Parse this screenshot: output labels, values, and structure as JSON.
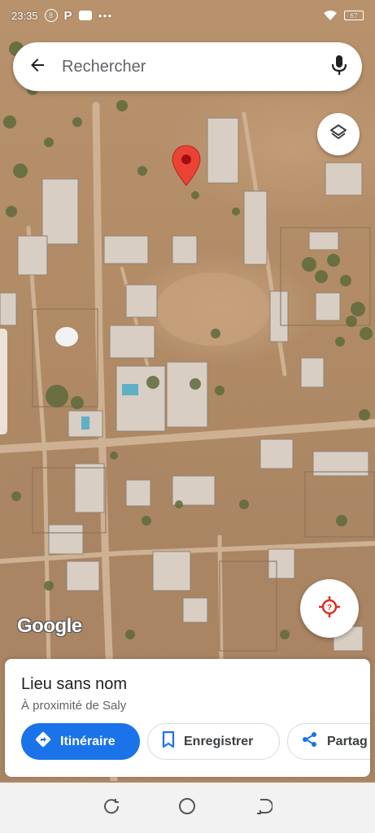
{
  "status_bar": {
    "time": "23:35",
    "notification_icons": [
      "circle-8-icon",
      "parking-icon",
      "gamepad-icon",
      "more-dots-icon"
    ],
    "wifi_icon": "wifi-icon",
    "battery_level": "67"
  },
  "search": {
    "placeholder": "Rechercher",
    "back_icon": "arrow-left-icon",
    "mic_icon": "microphone-icon"
  },
  "map": {
    "attribution": "Google",
    "layers_icon": "layers-icon",
    "location_icon": "my-location-icon",
    "pin_color": "#ea4335"
  },
  "place": {
    "title": "Lieu sans nom",
    "subtitle": "À proximité de Saly",
    "actions": {
      "directions": "Itinéraire",
      "save": "Enregistrer",
      "share": "Partag"
    }
  },
  "colors": {
    "accent": "#1a73e8",
    "pin": "#ea4335",
    "location_icon": "#d93025"
  }
}
